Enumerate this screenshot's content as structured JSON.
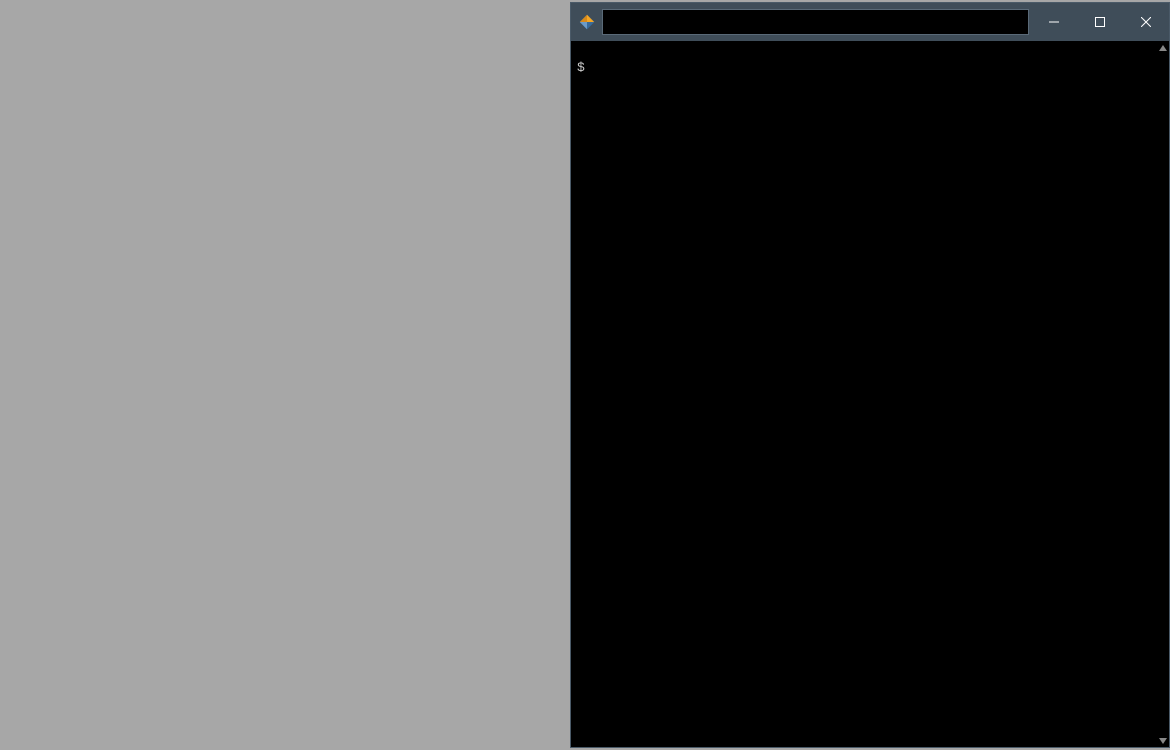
{
  "window": {
    "title": "",
    "address_value": ""
  },
  "terminal": {
    "lines": [
      "",
      "$"
    ]
  },
  "icons": {
    "app": "diamond-app-icon",
    "minimize": "minimize-icon",
    "maximize": "maximize-icon",
    "close": "close-icon",
    "scroll_up": "chevron-up-icon",
    "scroll_down": "chevron-down-icon"
  },
  "colors": {
    "desktop_bg": "#a7a7a7",
    "titlebar_bg": "#3f4d59",
    "terminal_bg": "#000000",
    "terminal_fg": "#cccccc"
  }
}
